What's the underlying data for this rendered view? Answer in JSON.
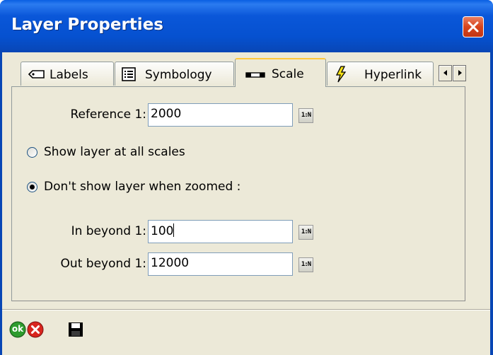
{
  "window": {
    "title": "Layer Properties"
  },
  "tabs": [
    {
      "label": "Labels",
      "icon": "label-tag-icon",
      "active": false
    },
    {
      "label": "Symbology",
      "icon": "list-icon",
      "active": false
    },
    {
      "label": "Scale",
      "icon": "scale-bar-icon",
      "active": true
    },
    {
      "label": "Hyperlink",
      "icon": "lightning-icon",
      "active": false
    }
  ],
  "scale": {
    "reference_label": "Reference 1:",
    "reference_value": "2000",
    "scale_button_text": "1:N",
    "option_all_scales": "Show layer at all scales",
    "option_zoomed": "Don't show layer when zoomed :",
    "selected_option": "zoomed",
    "in_beyond_label": "In beyond 1:",
    "in_beyond_value": "100",
    "out_beyond_label": "Out beyond 1:",
    "out_beyond_value": "12000"
  },
  "footer": {
    "ok_label": "ok",
    "cancel_icon": "cancel-icon",
    "save_icon": "save-disk-icon"
  },
  "colors": {
    "titlebar": "#0a56d8",
    "dialog_bg": "#ece9d8",
    "ok_green": "#2e9b2e",
    "cancel_red": "#d8251e"
  }
}
